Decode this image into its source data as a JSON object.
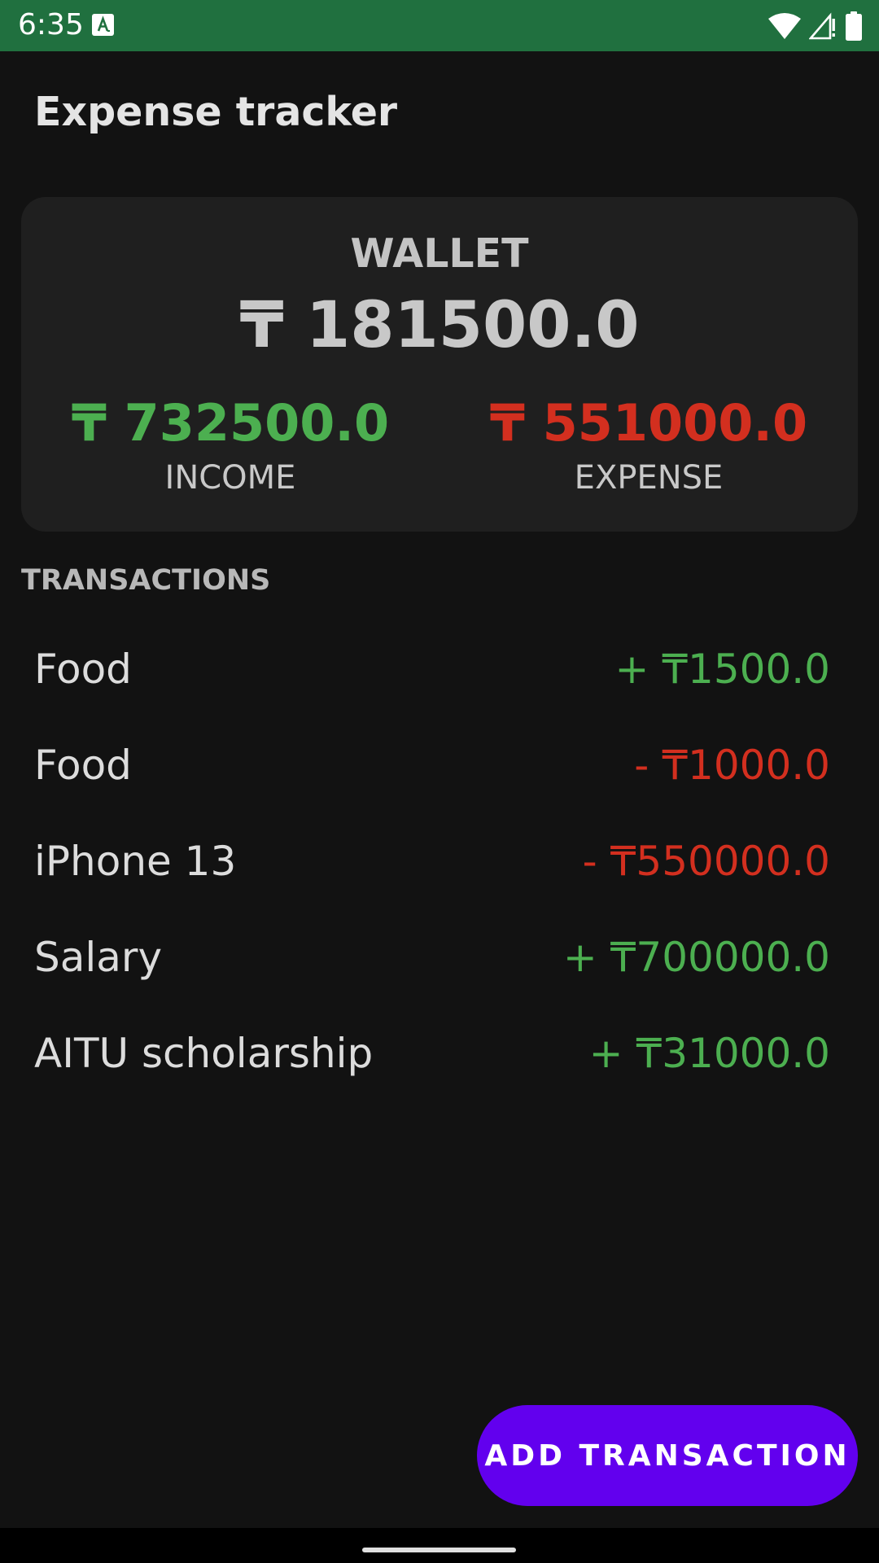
{
  "status_bar": {
    "time": "6:35",
    "icons": [
      "a-notification-icon",
      "wifi-icon",
      "cell-signal-icon",
      "battery-icon"
    ],
    "color": "#20703f"
  },
  "app_bar": {
    "title": "Expense tracker"
  },
  "wallet": {
    "label": "WALLET",
    "balance": "₸ 181500.0",
    "income": {
      "amount": "₸ 732500.0",
      "label": "INCOME"
    },
    "expense": {
      "amount": "₸ 551000.0",
      "label": "EXPENSE"
    }
  },
  "transactions": {
    "header": "TRANSACTIONS",
    "items": [
      {
        "name": "Food",
        "amount": "+ ₸1500.0",
        "type": "income"
      },
      {
        "name": "Food",
        "amount": "- ₸1000.0",
        "type": "expense"
      },
      {
        "name": "iPhone 13",
        "amount": "- ₸550000.0",
        "type": "expense"
      },
      {
        "name": "Salary",
        "amount": "+ ₸700000.0",
        "type": "income"
      },
      {
        "name": "AITU scholarship",
        "amount": "+ ₸31000.0",
        "type": "income"
      }
    ]
  },
  "fab": {
    "label": "ADD TRANSACTION"
  },
  "colors": {
    "income": "#4caf50",
    "expense": "#d32f1f",
    "accent": "#6200ee",
    "background": "#121212",
    "card": "#1f1f1f"
  }
}
